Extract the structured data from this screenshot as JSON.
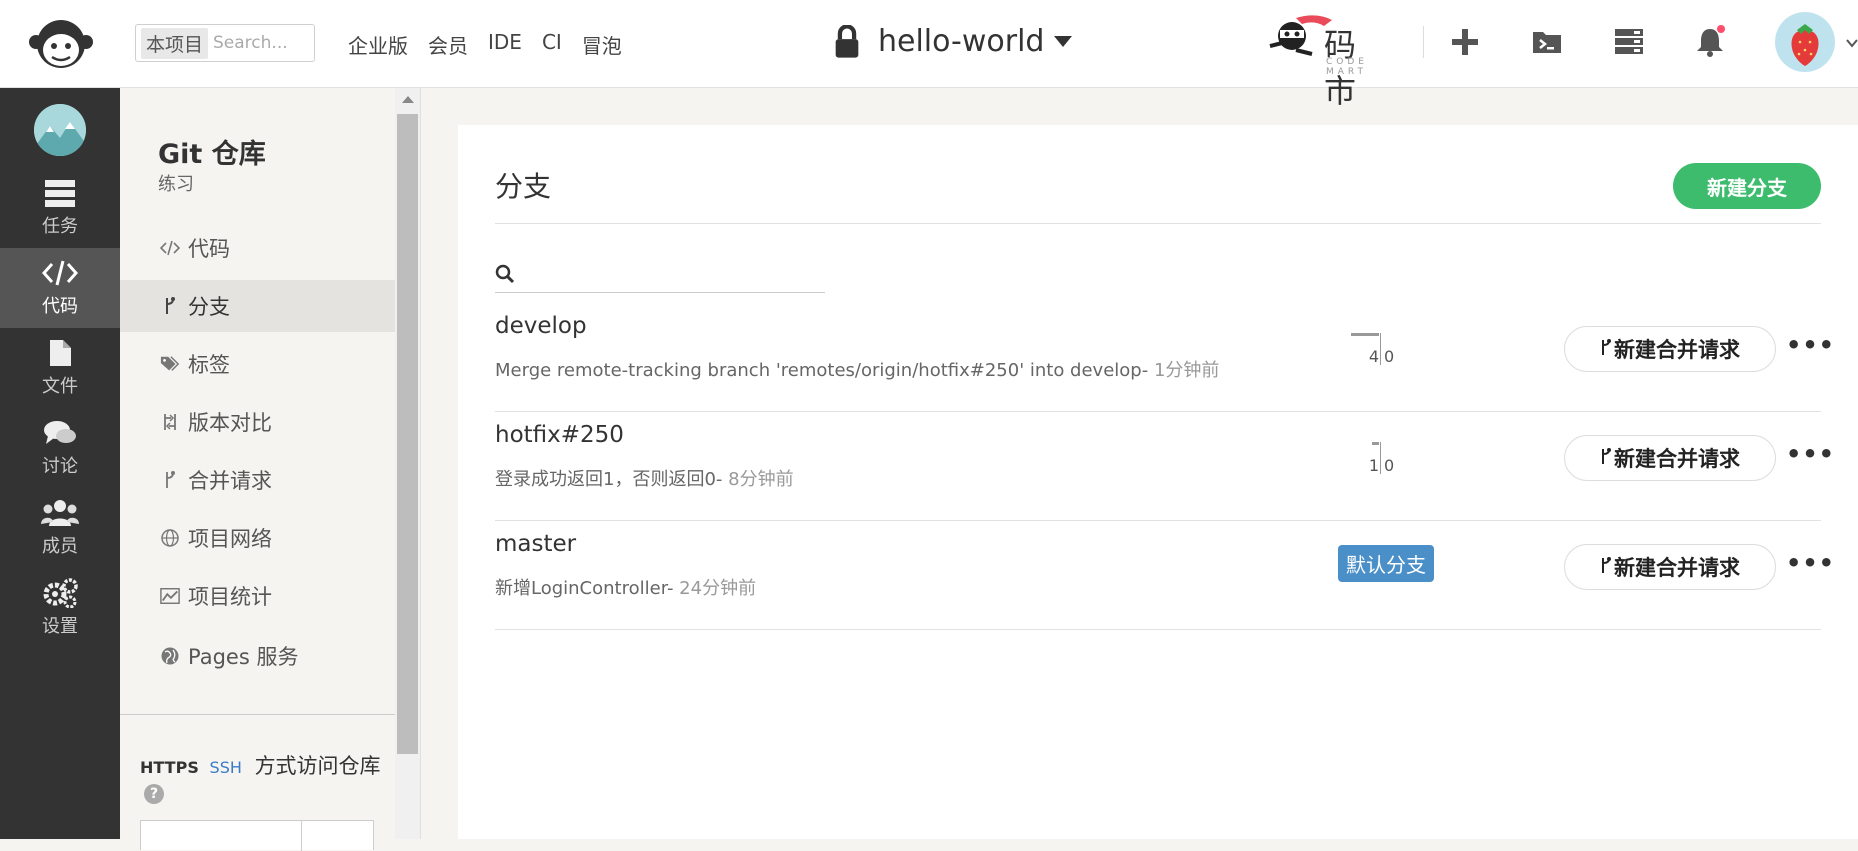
{
  "topbar": {
    "search_scope": "本项目",
    "search_placeholder": "Search...",
    "nav": [
      "企业版",
      "会员",
      "IDE",
      "CI",
      "冒泡"
    ],
    "project_name": "hello-world",
    "codemart_text": "码 市",
    "codemart_sub": "CODE MART",
    "notification_dot_color": "#ff4d6d"
  },
  "leftbar": {
    "items": [
      {
        "label": "任务",
        "icon": "tasks-icon"
      },
      {
        "label": "代码",
        "icon": "code-icon"
      },
      {
        "label": "文件",
        "icon": "file-icon"
      },
      {
        "label": "讨论",
        "icon": "discussion-icon"
      },
      {
        "label": "成员",
        "icon": "members-icon"
      },
      {
        "label": "设置",
        "icon": "settings-icon"
      }
    ],
    "active": "代码"
  },
  "subnav": {
    "repo_title": "Git 仓库",
    "repo_subtitle": "练习",
    "items": [
      {
        "label": "代码",
        "icon": "code-icon"
      },
      {
        "label": "分支",
        "icon": "branch-icon"
      },
      {
        "label": "标签",
        "icon": "tags-icon"
      },
      {
        "label": "版本对比",
        "icon": "compare-icon"
      },
      {
        "label": "合并请求",
        "icon": "merge-request-icon"
      },
      {
        "label": "项目网络",
        "icon": "network-icon"
      },
      {
        "label": "项目统计",
        "icon": "stats-icon"
      },
      {
        "label": "Pages 服务",
        "icon": "globe-icon"
      }
    ],
    "active": "分支",
    "access": {
      "https": "HTTPS",
      "ssh": "SSH",
      "text": "方式访问仓库",
      "help": "?"
    }
  },
  "main": {
    "title": "分支",
    "new_branch_label": "新建分支",
    "search_placeholder": "",
    "merge_request_label": "新建合并请求",
    "more_label": "•••",
    "default_badge": "默认分支",
    "branches": [
      {
        "name": "develop",
        "message": "Merge remote-tracking branch 'remotes/origin/hotfix#250' into develop- ",
        "time": "1分钟前",
        "behind": "4",
        "ahead": "0",
        "behind_fraction": 1.0,
        "is_default": false
      },
      {
        "name": "hotfix#250",
        "message": "登录成功返回1，否则返回0- ",
        "time": "8分钟前",
        "behind": "1",
        "ahead": "0",
        "behind_fraction": 0.25,
        "is_default": false
      },
      {
        "name": "master",
        "message": "新增LoginController- ",
        "time": "24分钟前",
        "behind": "",
        "ahead": "",
        "behind_fraction": 0,
        "is_default": true
      }
    ]
  },
  "colors": {
    "accent_green": "#3dbc6e",
    "default_badge": "#4a8fc7",
    "sidebar_dark": "#333333"
  }
}
